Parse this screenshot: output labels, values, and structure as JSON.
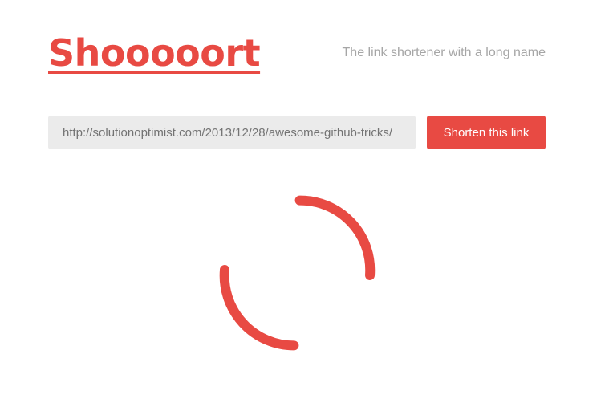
{
  "header": {
    "logo_text": "Shooooort",
    "tagline": "The link shortener with a long name"
  },
  "form": {
    "url_value": "http://solutionoptimist.com/2013/12/28/awesome-github-tricks/",
    "submit_label": "Shorten this link"
  },
  "spinner": {
    "icon": "loading-spinner-icon"
  },
  "colors": {
    "accent": "#e84a43",
    "input_background": "#ebebeb",
    "muted_text": "#a6a6a6"
  }
}
